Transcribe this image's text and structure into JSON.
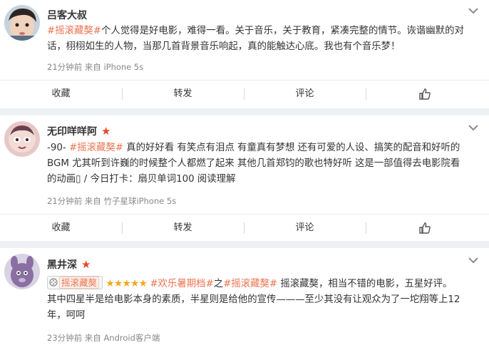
{
  "actions": {
    "favorite": "收藏",
    "repost": "转发",
    "comment": "评论"
  },
  "posts": [
    {
      "username": "吕客大叔",
      "line1_tag": "#摇滚藏獒#",
      "line1_rest": "个人觉得是好电影，难得一看。关于音乐，关于教育，紧凑完整的情节。诙谐幽默的对",
      "line2": "话，栩栩如生的人物，当那几首背景音乐响起，真的能触达心底。我也有个音乐梦！",
      "meta": "21分钟前 来自 iPhone 5s"
    },
    {
      "username": "无印咩咩阿",
      "line1_prefix": "-90- ",
      "line1_tag": "#摇滚藏獒#",
      "line1_rest": " 真的好好看 有笑点有泪点 有童真有梦想 还有可爱的人设、搞笑的配音和好听的",
      "line2": "BGM 尤其听到许巍的时候整个人都燃了起来 其他几首郑钧的歌也特好听 这是一部值得去电影院看",
      "line3": "的动画▯ / 今日打卡：扇贝单词100 阅读理解",
      "meta": "21分钟前 来自 竹子星球iPhone 5s"
    },
    {
      "username": "黑井深",
      "chip_label": "摇滚藏獒",
      "stars": "★★★★★",
      "tag_a": "#欢乐暑期档#",
      "mid": "之",
      "tag_b": "#摇滚藏獒#",
      "line1_rest": " 摇滚藏獒，相当不错的电影，五星好评。",
      "line2": "其中四星半是给电影本身的素质，半星则是给他的宣传———至少其没有让观众为了一坨翔等上12",
      "line3": "年，呵呵",
      "meta": "23分钟前 来自 Android客户端"
    }
  ]
}
